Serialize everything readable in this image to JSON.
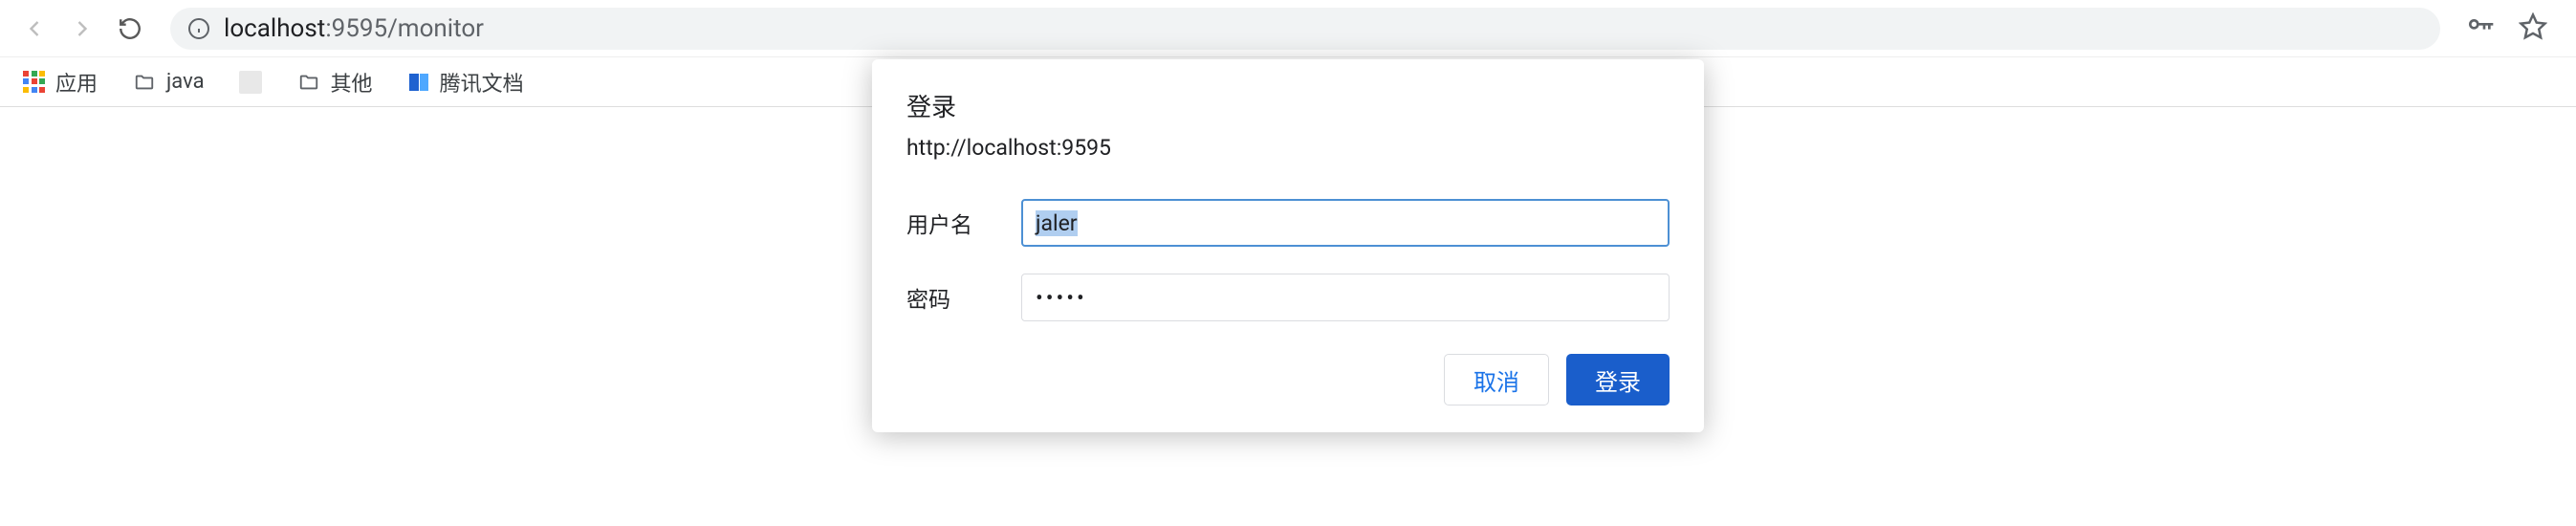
{
  "toolbar": {
    "url_host": "localhost",
    "url_port": ":9595",
    "url_path": "/monitor"
  },
  "bookmarks": {
    "apps_label": "应用",
    "java_label": "java",
    "other_label": "其他",
    "tencent_label": "腾讯文档"
  },
  "dialog": {
    "title": "登录",
    "origin": "http://localhost:9595",
    "username_label": "用户名",
    "username_value": "jaler",
    "password_label": "密码",
    "password_mask": "•••••",
    "cancel_label": "取消",
    "submit_label": "登录"
  }
}
